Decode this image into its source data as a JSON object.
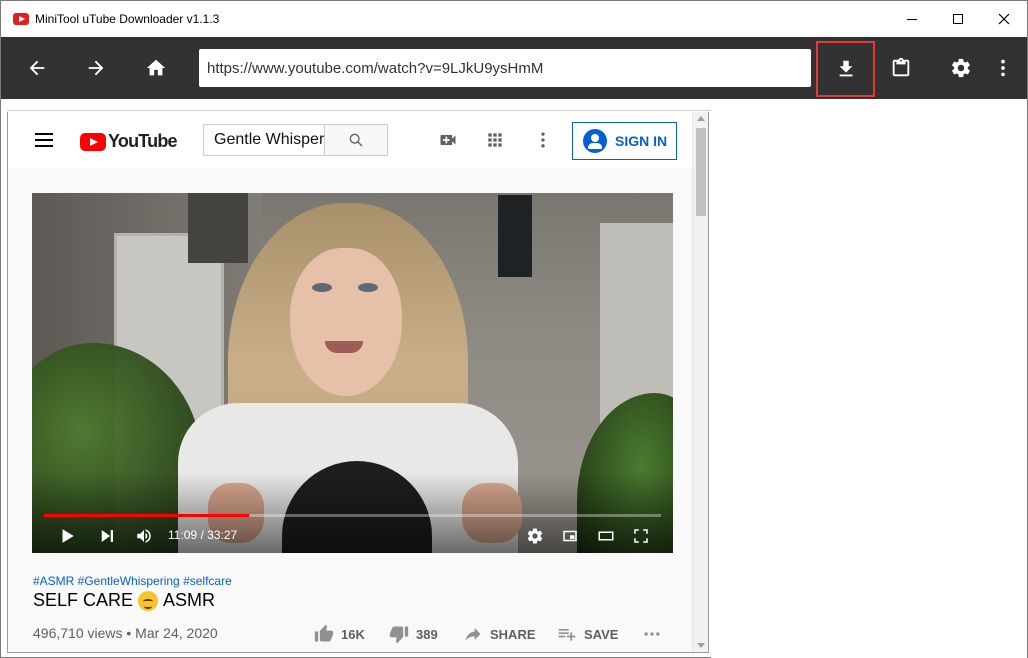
{
  "window": {
    "title": "MiniTool uTube Downloader v1.1.3"
  },
  "toolbar": {
    "url": "https://www.youtube.com/watch?v=9LJkU9ysHmM"
  },
  "youtube": {
    "logo_text": "YouTube",
    "search_value": "Gentle Whisper",
    "sign_in_label": "SIGN IN"
  },
  "video": {
    "time_current": "11:09",
    "time_total": "33:27",
    "time_display": "11:09 / 33:27",
    "progress_fraction": 0.333
  },
  "info": {
    "hashtags": "#ASMR #GentleWhispering #selfcare",
    "title_left": "SELF CARE",
    "title_right": "ASMR",
    "views_date": "496,710 views • Mar 24, 2020",
    "likes": "16K",
    "dislikes": "389",
    "share_label": "SHARE",
    "save_label": "SAVE"
  },
  "icons": {
    "back": "arrow-left-icon",
    "forward": "arrow-right-icon",
    "home": "home-icon",
    "download": "download-icon",
    "clipboard": "clipboard-icon",
    "settings": "gear-icon",
    "more": "more-vertical-icon"
  },
  "colors": {
    "toolbar_bg": "#323232",
    "highlight_border": "#e53935",
    "youtube_red": "#ff0000",
    "link_blue": "#065fd4"
  }
}
